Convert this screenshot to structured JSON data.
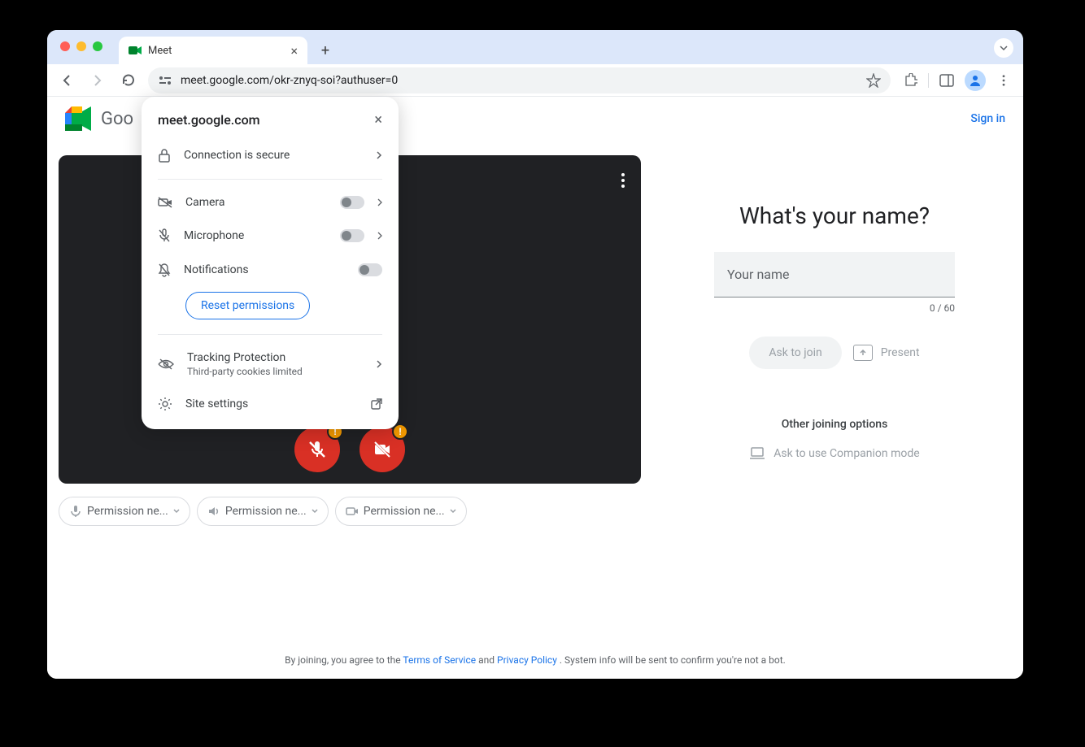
{
  "browser": {
    "tab_title": "Meet",
    "url": "meet.google.com/okr-znyq-soi?authuser=0"
  },
  "popup": {
    "title": "meet.google.com",
    "secure": "Connection is secure",
    "camera": "Camera",
    "microphone": "Microphone",
    "notifications": "Notifications",
    "reset": "Reset permissions",
    "tracking": "Tracking Protection",
    "tracking_sub": "Third-party cookies limited",
    "site_settings": "Site settings"
  },
  "header": {
    "brand": "Google Meet",
    "brand_visible": "Goo",
    "signin": "Sign in"
  },
  "chips": {
    "mic": "Permission ne...",
    "speaker": "Permission ne...",
    "cam": "Permission ne..."
  },
  "right": {
    "question": "What's your name?",
    "placeholder": "Your name",
    "value": "",
    "count": "0 / 60",
    "ask": "Ask to join",
    "present": "Present",
    "other": "Other joining options",
    "companion": "Ask to use Companion mode"
  },
  "footer": {
    "prefix": "By joining, you agree to the ",
    "tos": "Terms of Service",
    "and": " and ",
    "pp": "Privacy Policy",
    "suffix": ". System info will be sent to confirm you're not a bot."
  }
}
